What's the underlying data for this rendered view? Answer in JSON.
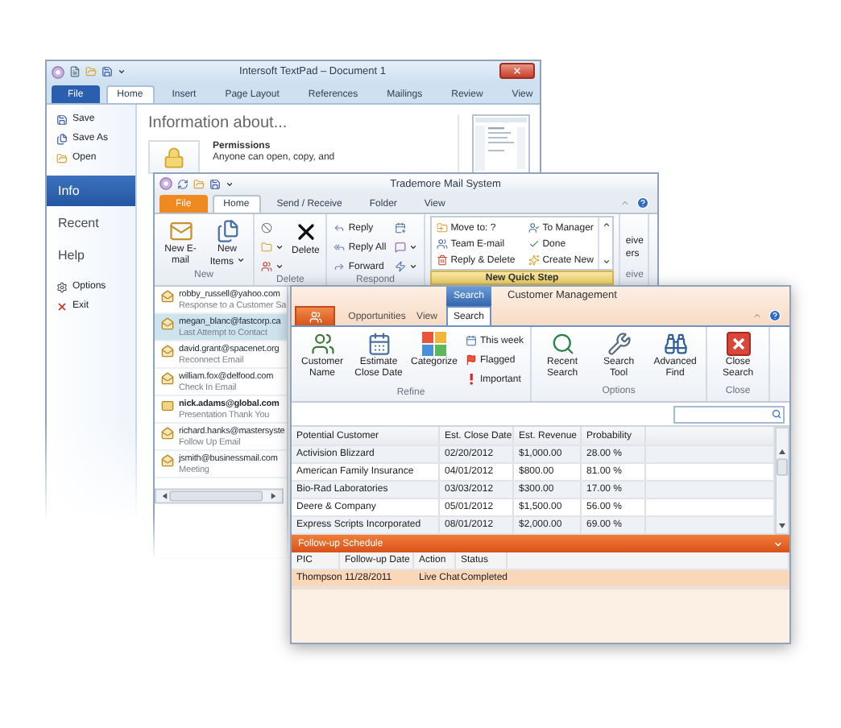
{
  "textpad_window": {
    "title": "Intersoft TextPad – Document 1",
    "tabs": [
      {
        "label": "File",
        "kind": "file",
        "selected": false
      },
      {
        "label": "Home",
        "kind": "tab",
        "selected": true
      },
      {
        "label": "Insert",
        "kind": "tab",
        "selected": false
      },
      {
        "label": "Page Layout",
        "kind": "tab",
        "selected": false
      },
      {
        "label": "References",
        "kind": "tab",
        "selected": false
      },
      {
        "label": "Mailings",
        "kind": "tab",
        "selected": false
      },
      {
        "label": "Review",
        "kind": "tab",
        "selected": false
      },
      {
        "label": "View",
        "kind": "tab",
        "selected": false
      }
    ],
    "nav": [
      {
        "label": "Save",
        "kind": "command"
      },
      {
        "label": "Save As",
        "kind": "command"
      },
      {
        "label": "Open",
        "kind": "command"
      },
      {
        "label": "Info",
        "kind": "section",
        "selected": true
      },
      {
        "label": "Recent",
        "kind": "section",
        "selected": false
      },
      {
        "label": "Help",
        "kind": "section",
        "selected": false
      },
      {
        "label": "Options",
        "kind": "command"
      },
      {
        "label": "Exit",
        "kind": "command"
      }
    ],
    "heading": "Information about...",
    "permissions": {
      "title": "Permissions",
      "text": "Anyone can open, copy, and"
    }
  },
  "mail_window": {
    "title": "Trademore Mail System",
    "tabs": [
      {
        "label": "File",
        "kind": "file",
        "selected": false
      },
      {
        "label": "Home",
        "kind": "tab",
        "selected": true
      },
      {
        "label": "Send / Receive",
        "kind": "tab",
        "selected": false
      },
      {
        "label": "Folder",
        "kind": "tab",
        "selected": false
      },
      {
        "label": "View",
        "kind": "tab",
        "selected": false
      }
    ],
    "ribbon": [
      {
        "label": "New",
        "buttons": [
          {
            "kind": "large",
            "label": "New E-mail",
            "dropdown": false
          },
          {
            "kind": "large",
            "label": "New Items",
            "dropdown": true
          }
        ]
      },
      {
        "label": "Delete",
        "buttons": [
          {
            "kind": "icon",
            "dropdown": false
          },
          {
            "kind": "icon",
            "dropdown": true
          },
          {
            "kind": "icon",
            "dropdown": true
          },
          {
            "kind": "large",
            "label": "Delete",
            "dropdown": false
          }
        ]
      },
      {
        "label": "Respond",
        "buttons": [
          {
            "kind": "small",
            "label": "Reply",
            "dropdown": false
          },
          {
            "kind": "small",
            "label": "Reply All",
            "dropdown": false
          },
          {
            "kind": "small",
            "label": "Forward",
            "dropdown": false
          },
          {
            "kind": "icon",
            "dropdown": false
          },
          {
            "kind": "icon",
            "dropdown": true
          },
          {
            "kind": "icon",
            "dropdown": true
          }
        ]
      },
      {
        "buttons": [
          {
            "kind": "gallery",
            "items": [
              "Move to: ?",
              "To Manager",
              "Team E-mail",
              "Done",
              "Reply & Delete",
              "Create New"
            ],
            "menu_item": "New Quick Step"
          }
        ]
      },
      {
        "label": "eive",
        "buttons": [
          {
            "kind": "lines",
            "lines": [
              "eive",
              "ers"
            ]
          }
        ]
      }
    ],
    "messages": [
      {
        "sender": "robby_russell@yahoo.com",
        "subject": "Response to a Customer Sa",
        "selected": false,
        "unread": false
      },
      {
        "sender": "megan_blanc@fastcorp.ca",
        "subject": "Last Attempt to Contact",
        "selected": true,
        "unread": false
      },
      {
        "sender": "david.grant@spacenet.org",
        "subject": "Reconnect Email",
        "selected": false,
        "unread": false
      },
      {
        "sender": "william.fox@delfood.com",
        "subject": "Check In Email",
        "selected": false,
        "unread": false
      },
      {
        "sender": "nick.adams@global.com",
        "subject": "Presentation Thank You",
        "selected": false,
        "unread": true
      },
      {
        "sender": "richard.hanks@mastersyste",
        "subject": "Follow Up Email",
        "selected": false,
        "unread": false
      },
      {
        "sender": "jsmith@businessmail.com",
        "subject": "Meeting",
        "selected": false,
        "unread": false
      }
    ]
  },
  "crm_window": {
    "context_label": "Search",
    "title": "Customer Management",
    "tabs": [
      {
        "kind": "app",
        "selected": false
      },
      {
        "label": "Opportunities",
        "kind": "tab",
        "selected": false
      },
      {
        "label": "View",
        "kind": "tab",
        "selected": false
      },
      {
        "label": "Search",
        "kind": "tab",
        "selected": true
      }
    ],
    "ribbon": [
      {
        "label": "Refine",
        "buttons": [
          {
            "kind": "large",
            "label": "Customer Name",
            "dropdown": false
          },
          {
            "kind": "large",
            "label": "Estimate Close Date",
            "dropdown": false
          },
          {
            "kind": "large",
            "label": "Categorize",
            "dropdown": false
          },
          {
            "kind": "small",
            "label": "This week",
            "dropdown": false
          },
          {
            "kind": "small",
            "label": "Flagged",
            "dropdown": false
          },
          {
            "kind": "small",
            "label": "Important",
            "dropdown": false
          }
        ]
      },
      {
        "label": "Options",
        "buttons": [
          {
            "kind": "large",
            "label": "Recent Search",
            "dropdown": false
          },
          {
            "kind": "large",
            "label": "Search Tool",
            "dropdown": false
          },
          {
            "kind": "large",
            "label": "Advanced Find",
            "dropdown": false
          }
        ]
      },
      {
        "label": "Close",
        "buttons": [
          {
            "kind": "large",
            "label": "Close Search",
            "dropdown": false
          }
        ]
      }
    ],
    "table": {
      "columns": [
        "Potential Customer",
        "Est. Close Date",
        "Est. Revenue",
        "Probability"
      ],
      "rows": [
        [
          "Activision Blizzard",
          "02/20/2012",
          "$1,000.00",
          "28.00 %"
        ],
        [
          "American Family Insurance",
          "04/01/2012",
          "$800.00",
          "81.00 %"
        ],
        [
          "Bio-Rad Laboratories",
          "03/03/2012",
          "$300.00",
          "17.00 %"
        ],
        [
          "Deere & Company",
          "05/01/2012",
          "$1,500.00",
          "56.00 %"
        ],
        [
          "Express Scripts Incorporated",
          "08/01/2012",
          "$2,000.00",
          "69.00 %"
        ]
      ]
    },
    "followup": {
      "title": "Follow-up Schedule",
      "columns": [
        "PIC",
        "Follow-up Date",
        "Action",
        "Status"
      ],
      "rows": [
        {
          "cells": [
            "Thompson",
            "11/28/2011",
            "Live Chat",
            "Completed"
          ],
          "selected": true
        }
      ]
    }
  }
}
